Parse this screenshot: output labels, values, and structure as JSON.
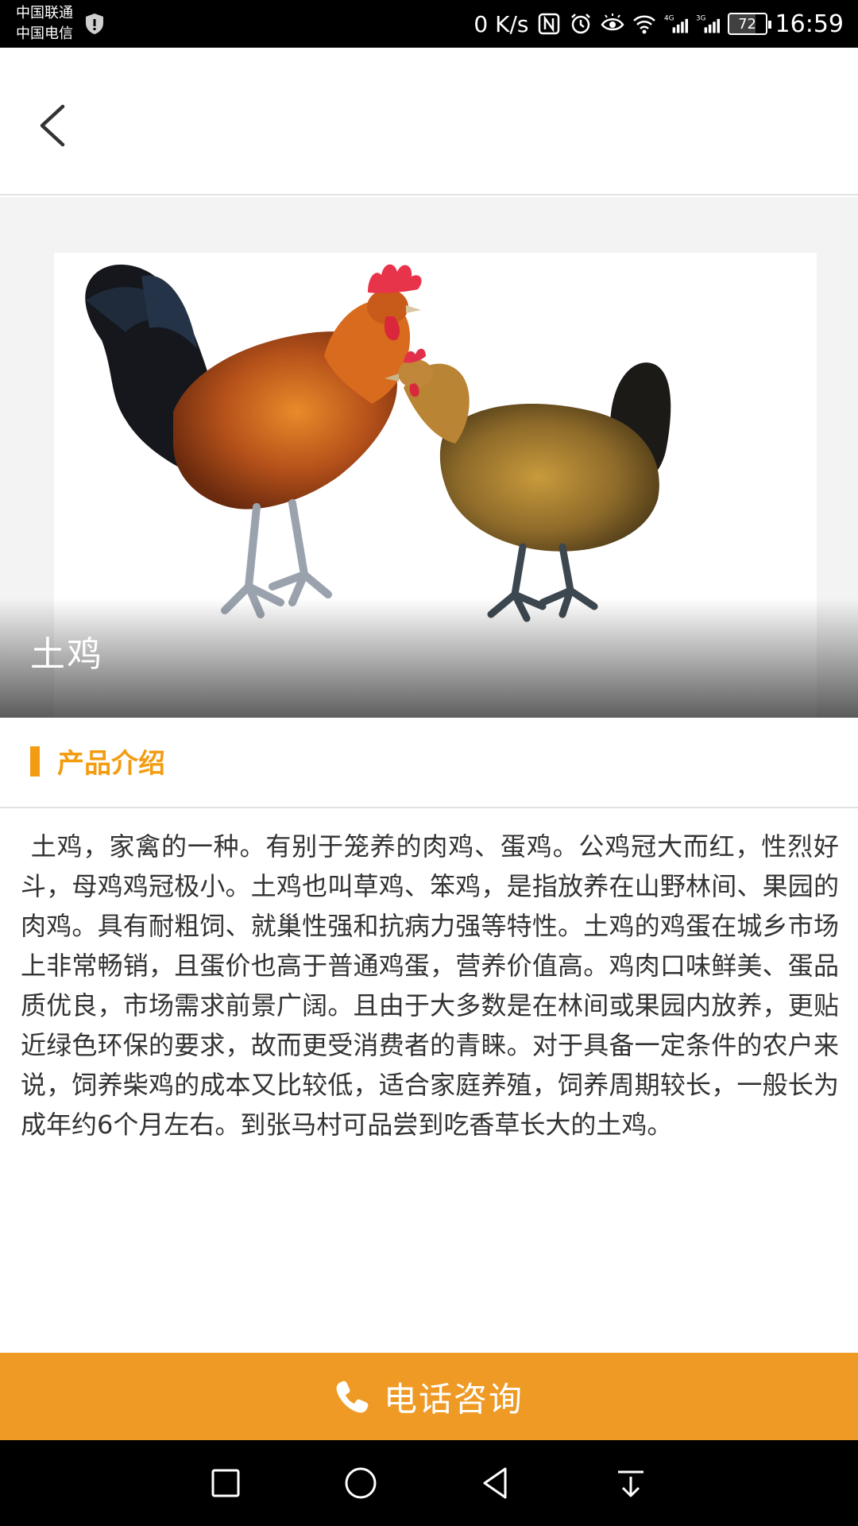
{
  "status_bar": {
    "carrier_1": "中国联通",
    "carrier_2": "中国电信",
    "speed": "0 K/s",
    "battery": "72",
    "battery_fraction": 0.72,
    "time": "16:59",
    "icons": [
      "shield-icon",
      "nfc-icon",
      "alarm-icon",
      "eye-icon",
      "wifi-icon",
      "signal-4g-icon",
      "signal-3g-icon",
      "battery-icon"
    ]
  },
  "header": {
    "back_icon": "chevron-left-icon"
  },
  "hero": {
    "title": "土鸡",
    "image": "rooster-and-hen-photo"
  },
  "section": {
    "title": "产品介绍"
  },
  "description": {
    "text": "土鸡，家禽的一种。有别于笼养的肉鸡、蛋鸡。公鸡冠大而红，性烈好斗，母鸡鸡冠极小。土鸡也叫草鸡、笨鸡，是指放养在山野林间、果园的肉鸡。具有耐粗饲、就巢性强和抗病力强等特性。土鸡的鸡蛋在城乡市场上非常畅销，且蛋价也高于普通鸡蛋，营养价值高。鸡肉口味鲜美、蛋品质优良，市场需求前景广阔。且由于大多数是在林间或果园内放养，更贴近绿色环保的要求，故而更受消费者的青睐。对于具备一定条件的农户来说，饲养柴鸡的成本又比较低，适合家庭养殖，饲养周期较长，一般长为成年约6个月左右。到张马村可品尝到吃香草长大的土鸡。"
  },
  "call_button": {
    "label": "电话咨询",
    "icon": "phone-icon"
  },
  "nav_bar": {
    "icons": [
      "recents-square-icon",
      "home-circle-icon",
      "back-triangle-icon",
      "notification-pulldown-icon"
    ]
  },
  "colors": {
    "accent": "#f39c12",
    "call_bar": "#ee9a25",
    "text": "#333333",
    "divider": "#e2e2e2"
  }
}
